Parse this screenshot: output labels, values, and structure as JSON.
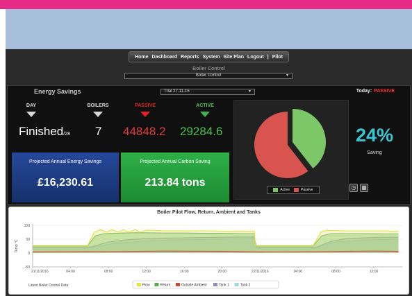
{
  "nav": [
    "Home",
    "Dashboard",
    "Reports",
    "System",
    "Site Plan",
    "Logout",
    "|",
    "Pilot"
  ],
  "boiler_control": {
    "title": "Boiler Control",
    "selected": "Boiler Control"
  },
  "energy": {
    "title": "Energy Savings",
    "trial_selected": "Trial 27-11-15",
    "today_label": "Today:",
    "today_mode": "PASSIVE"
  },
  "stats": {
    "day": {
      "label": "DAY",
      "value": "Finished",
      "suffix": "/28"
    },
    "boilers": {
      "label": "BOILERS",
      "value": "7"
    },
    "passive": {
      "label": "PASSIVE",
      "value": "44848.2"
    },
    "active": {
      "label": "ACTIVE",
      "value": "29284.6"
    }
  },
  "tiles": {
    "energy_savings": {
      "label": "Projected Annual Energy Savings",
      "value": "£16,230.61"
    },
    "carbon_saving": {
      "label": "Projected Annual Carbon Saving",
      "value": "213.84 tons"
    }
  },
  "pie": {
    "legend_active": "Active",
    "legend_passive": "Passive",
    "active_share": 0.395,
    "active_color": "#7cc868",
    "passive_color": "#d9534f"
  },
  "saving": {
    "percent": "24%",
    "label": "Saving"
  },
  "icons": {
    "clock": "clock-icon",
    "calendar": "calendar-icon"
  },
  "colors": {
    "pink": "#e62a86",
    "sky": "#a8bfdc",
    "tile_blue": "#1e3f8a",
    "tile_green": "#24a23c",
    "passive_red": "#e23a3a",
    "active_green": "#47c04f"
  },
  "chart_data": {
    "type": "line",
    "title": "Boiler Pilot Flow, Return, Ambient and Tanks",
    "ylabel": "Temp °C",
    "ylim": [
      -50,
      100
    ],
    "y_ticks": [
      "100",
      "50",
      "0",
      "-50"
    ],
    "x_ticks": [
      "21/11/2016",
      "04:00",
      "08:00",
      "12:00",
      "16:00",
      "20:00",
      "22/11/2016",
      "04:00",
      "08:00",
      "12:00"
    ],
    "x_hours": [
      0,
      4,
      8,
      12,
      16,
      20,
      24,
      28,
      32,
      36
    ],
    "footer_left": "Latest Boiler Control Data",
    "series": [
      {
        "name": "Flow",
        "color": "#e8e23a",
        "x": [
          0,
          5.8,
          6.5,
          7.2,
          7.8,
          8.4,
          9.0,
          9.6,
          10.2,
          10.8,
          11.4,
          12,
          14,
          16,
          18,
          20,
          22,
          23.4,
          23.5,
          29.6,
          30.4,
          31.0,
          33,
          35,
          37,
          38.6
        ],
        "y": [
          27,
          27,
          75,
          84,
          76,
          84,
          76,
          84,
          76,
          84,
          76,
          83,
          80,
          80,
          80,
          79,
          78,
          78,
          27,
          27,
          75,
          82,
          80,
          80,
          80,
          78
        ]
      },
      {
        "name": "Return",
        "color": "#55b04a",
        "x": [
          0,
          5.8,
          6.6,
          7.6,
          8.6,
          9.6,
          10.6,
          12,
          14,
          16,
          18,
          20,
          22,
          23.4,
          23.5,
          29.6,
          30.5,
          31.5,
          33,
          35,
          37,
          38.6
        ],
        "y": [
          26,
          26,
          62,
          70,
          71,
          72,
          73,
          73,
          72,
          72,
          71,
          71,
          70,
          70,
          26,
          26,
          62,
          70,
          70,
          70,
          69,
          69
        ]
      },
      {
        "name": "Outside Ambient",
        "color": "#d9423a",
        "x": [
          0,
          8,
          14,
          20,
          24,
          30,
          36,
          38.6
        ],
        "y": [
          4,
          5,
          7,
          6,
          4,
          5,
          7,
          6
        ]
      },
      {
        "name": "Tank 1",
        "color": "#8a8ac4",
        "x": [
          0,
          6.2,
          8,
          10,
          12,
          16,
          20,
          23.4,
          23.6,
          30,
          31.5,
          33,
          36,
          38.6
        ],
        "y": [
          22,
          22,
          40,
          48,
          52,
          55,
          57,
          58,
          22,
          22,
          42,
          52,
          56,
          57
        ]
      },
      {
        "name": "Tank 2",
        "color": "#9fd6e4",
        "x": [
          0,
          6.2,
          8.5,
          12,
          16,
          20,
          23.4,
          23.6,
          30,
          32,
          36,
          38.6
        ],
        "y": [
          20,
          20,
          34,
          44,
          48,
          50,
          51,
          20,
          20,
          40,
          48,
          50
        ]
      }
    ]
  }
}
